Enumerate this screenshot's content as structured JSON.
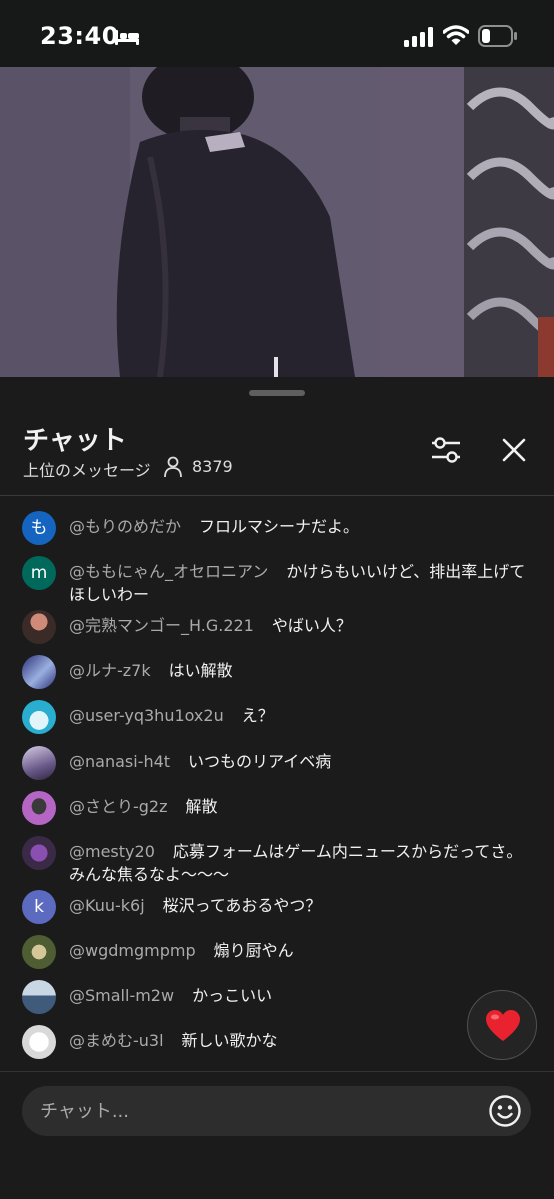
{
  "status_bar": {
    "time": "23:40",
    "icons": [
      "bed-icon",
      "signal-icon",
      "wifi-icon",
      "battery-icon"
    ]
  },
  "chat": {
    "title": "チャット",
    "subtitle": "上位のメッセージ",
    "viewer_count": "8379",
    "header_icons": [
      "person-icon",
      "filter-icon",
      "close-icon"
    ],
    "messages": [
      {
        "author": "@もりのめだか",
        "text": "フロルマシーナだよ。",
        "avatar_letter": "も",
        "avatar_color": "#1565c0"
      },
      {
        "author": "@ももにゃん_オセロニアン",
        "text": "かけらもいいけど、排出率上げてほしいわー",
        "avatar_letter": "m",
        "avatar_color": "#00695c"
      },
      {
        "author": "@完熟マンゴー_H.G.221",
        "text": "やばい人？",
        "avatar_letter": "",
        "avatar_color": "#6b4a3c"
      },
      {
        "author": "@ルナ-z7k",
        "text": "はい解散",
        "avatar_letter": "",
        "avatar_color": "#3b3f86"
      },
      {
        "author": "@user-yq3hu1ox2u",
        "text": "え？",
        "avatar_letter": "",
        "avatar_color": "#33b5d6"
      },
      {
        "author": "@nanasi-h4t",
        "text": "いつものリアイベ病",
        "avatar_letter": "",
        "avatar_color": "#8a7aa8"
      },
      {
        "author": "@さとり-g2z",
        "text": "解散",
        "avatar_letter": "",
        "avatar_color": "#b05bbd"
      },
      {
        "author": "@mesty20",
        "text": "応募フォームはゲーム内ニュースからだってさ。みんな焦るなよ〜〜〜",
        "avatar_letter": "",
        "avatar_color": "#5c3d6e"
      },
      {
        "author": "@Kuu-k6j",
        "text": "桜沢ってあおるやつ？",
        "avatar_letter": "k",
        "avatar_color": "#5c6bc0"
      },
      {
        "author": "@wgdmgmpmp",
        "text": "煽り厨やん",
        "avatar_letter": "",
        "avatar_color": "#4e5d32"
      },
      {
        "author": "@Small-m2w",
        "text": "かっこいい",
        "avatar_letter": "",
        "avatar_color": "#5e7ea1"
      },
      {
        "author": "@まめむ-u3l",
        "text": "新しい歌かな",
        "avatar_letter": "",
        "avatar_color": "#e8e8e8"
      }
    ],
    "input_placeholder": "チャット...",
    "reaction_icon": "heart-icon",
    "emoji_icon": "smiley-icon"
  }
}
